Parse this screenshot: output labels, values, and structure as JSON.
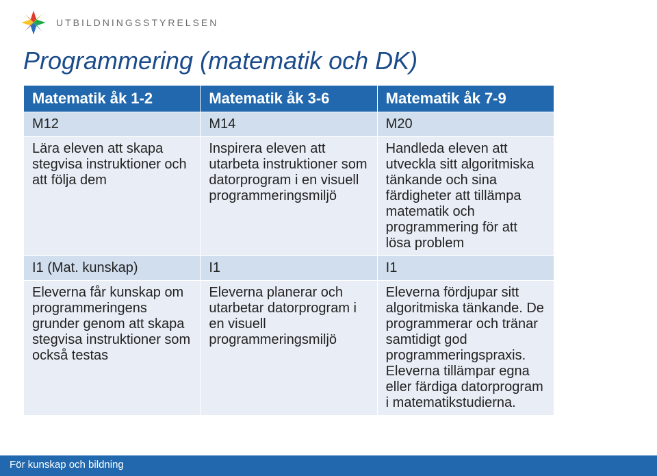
{
  "header": {
    "org_name": "UTBILDNINGSSTYRELSEN"
  },
  "title": "Programmering (matematik och DK)",
  "table": {
    "head": {
      "c1": "Matematik åk 1-2",
      "c2": "Matematik åk 3-6",
      "c3": "Matematik åk 7-9"
    },
    "row1": {
      "c1": "M12",
      "c2": "M14",
      "c3": "M20"
    },
    "row2": {
      "c1": "Lära eleven att skapa stegvisa instruktioner och att följa dem",
      "c2": "Inspirera eleven att utarbeta instruktioner som datorprogram i en visuell programmeringsmiljö",
      "c3": "Handleda eleven att utveckla sitt algoritmiska tänkande och sina färdigheter att tillämpa matematik och programmering för att lösa problem"
    },
    "row3": {
      "c1": "I1 (Mat. kunskap)",
      "c2": "I1",
      "c3": "I1"
    },
    "row4": {
      "c1": "Eleverna får kunskap om programmeringens grunder genom att skapa stegvisa instruktioner som också testas",
      "c2": "Eleverna planerar och utarbetar datorprogram i en visuell programmeringsmiljö",
      "c3": "Eleverna fördjupar sitt algoritmiska tänkande. De programmerar och tränar samtidigt god programmeringspraxis. Eleverna tillämpar egna eller färdiga datorprogram i matematikstudierna."
    }
  },
  "footer": "För kunskap och bildning"
}
